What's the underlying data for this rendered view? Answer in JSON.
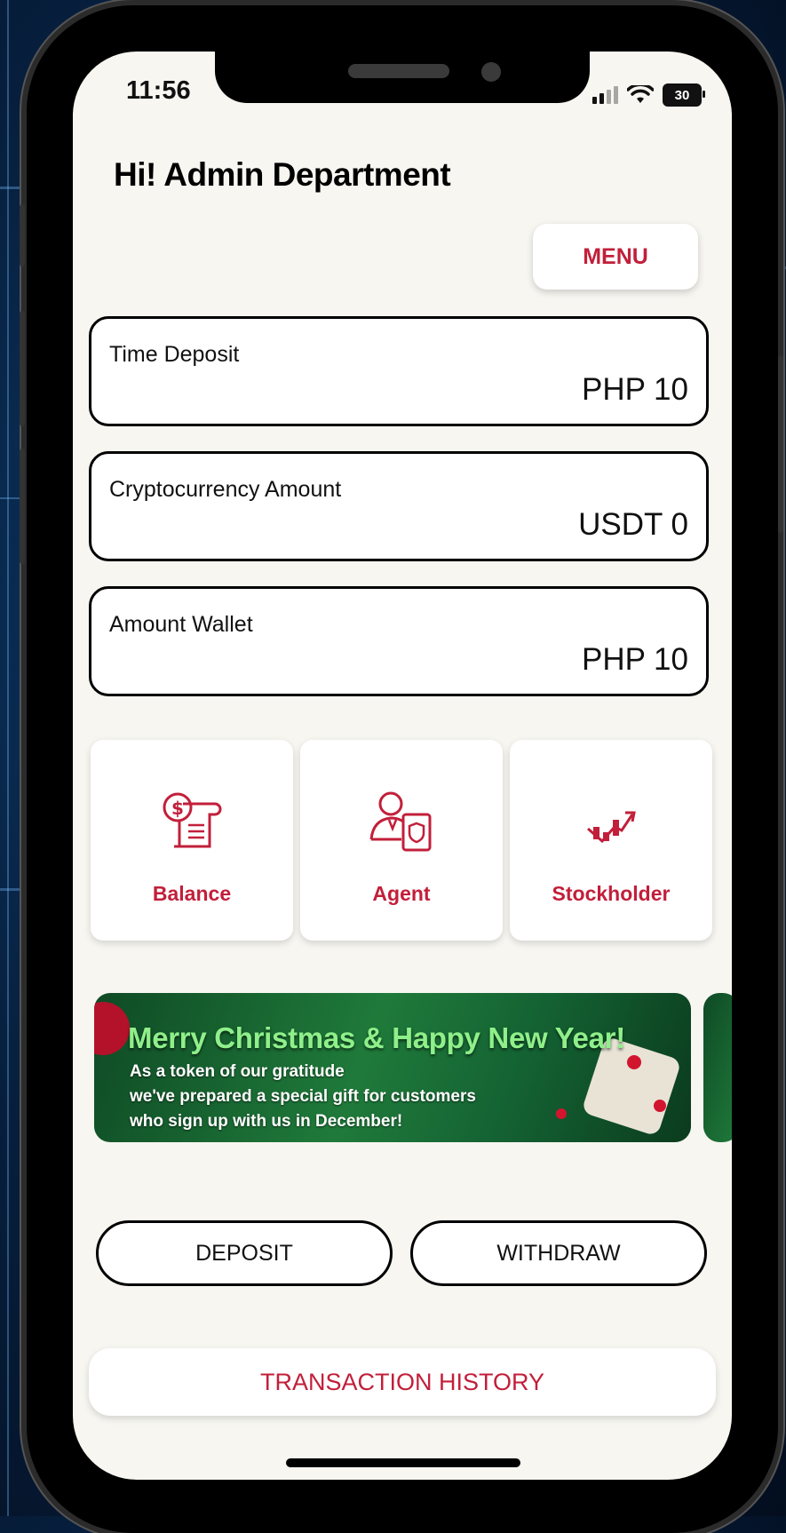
{
  "status_bar": {
    "time": "11:56",
    "battery": "30"
  },
  "header": {
    "greeting": "Hi! Admin Department",
    "menu_label": "MENU"
  },
  "accounts": [
    {
      "label": "Time Deposit",
      "value": "PHP 10"
    },
    {
      "label": "Cryptocurrency Amount",
      "value": "USDT 0"
    },
    {
      "label": "Amount Wallet",
      "value": "PHP 10"
    }
  ],
  "tiles": [
    {
      "label": "Balance",
      "icon": "receipt-dollar-icon"
    },
    {
      "label": "Agent",
      "icon": "agent-document-icon"
    },
    {
      "label": "Stockholder",
      "icon": "stock-chart-icon"
    }
  ],
  "banner": {
    "headline": "Merry Christmas & Happy New Year!",
    "line1": "As a token of our gratitude",
    "line2": "we've prepared a special gift for customers",
    "line3": "who sign up with us in December!"
  },
  "actions": {
    "deposit": "DEPOSIT",
    "withdraw": "WITHDRAW",
    "history": "TRANSACTION HISTORY"
  },
  "colors": {
    "accent": "#c21f3a",
    "screen_bg": "#f7f6f1"
  }
}
